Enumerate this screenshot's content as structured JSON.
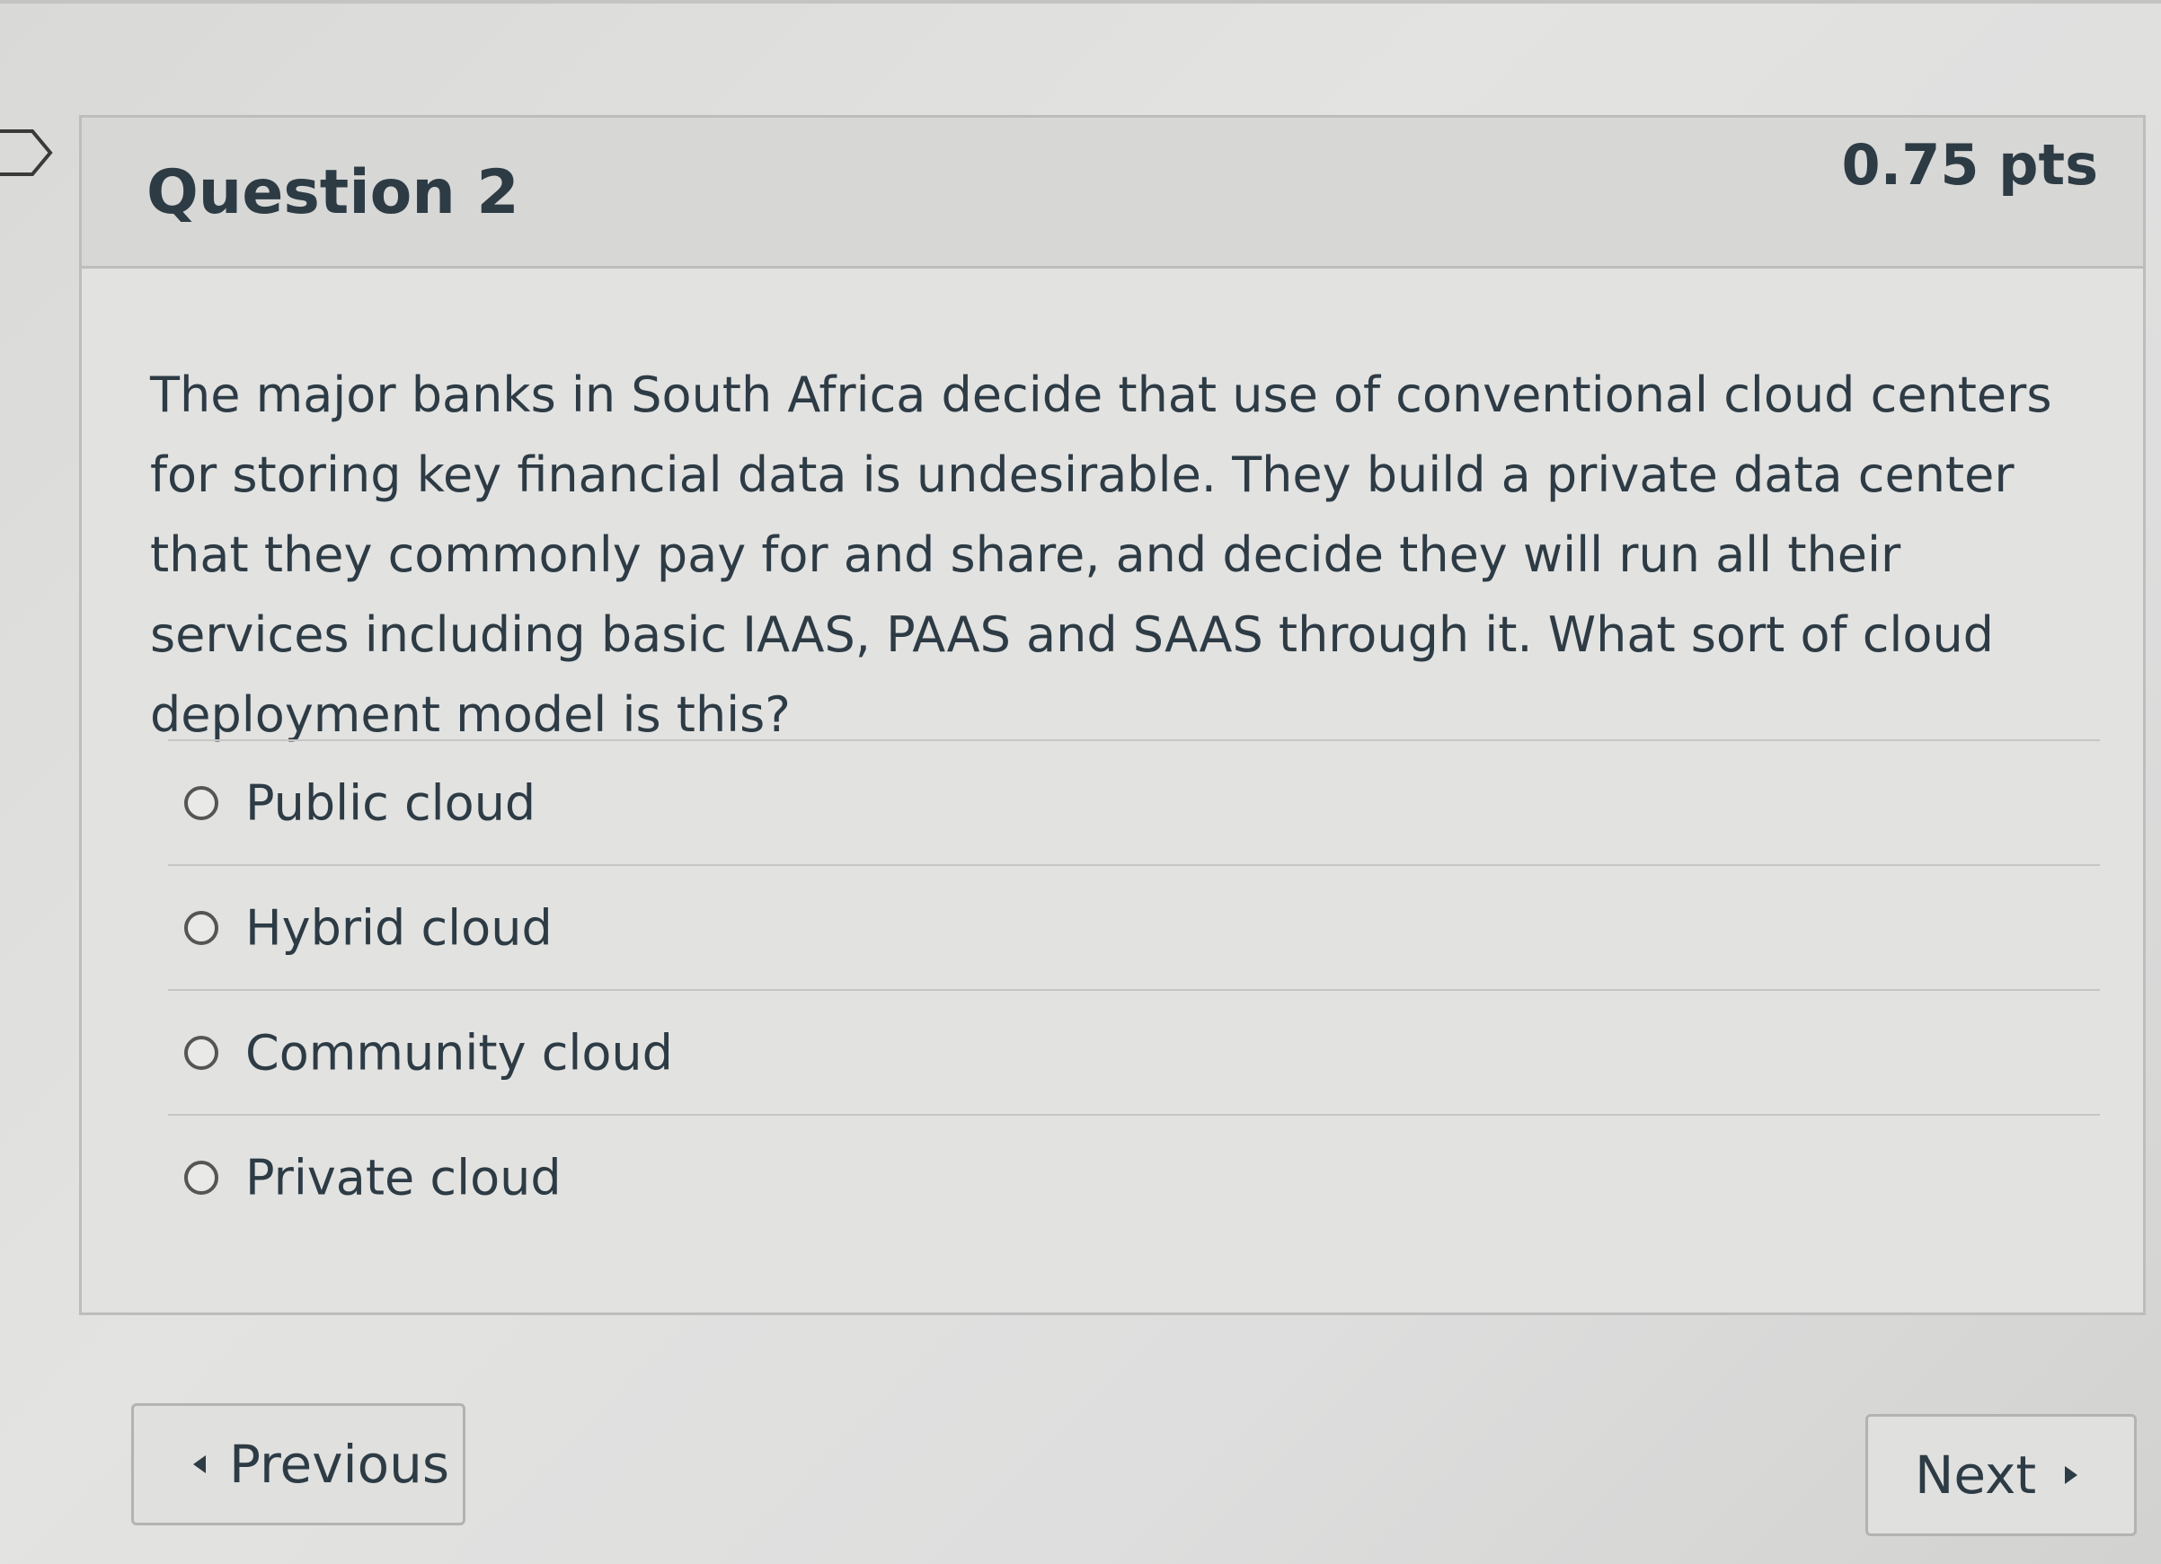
{
  "question": {
    "title": "Question 2",
    "points": "0.75 pts",
    "body": "The major banks in South Africa decide that use of conventional cloud centers for storing key financial data is undesirable. They build a private data center that they commonly pay for and share, and decide they will run all their services including basic IAAS, PAAS and SAAS through it. What sort of cloud deployment model is this?",
    "answers": [
      {
        "label": "Public cloud",
        "selected": false
      },
      {
        "label": "Hybrid cloud",
        "selected": false
      },
      {
        "label": "Community cloud",
        "selected": false
      },
      {
        "label": "Private cloud",
        "selected": false
      }
    ]
  },
  "navigation": {
    "previous_label": "Previous",
    "next_label": "Next"
  },
  "icons": {
    "flag": "flag-icon",
    "previous": "caret-left-icon",
    "next": "caret-right-icon"
  },
  "colors": {
    "text": "#2d3b45",
    "border": "#bdbdbb",
    "header_bg": "#d7d7d5"
  }
}
